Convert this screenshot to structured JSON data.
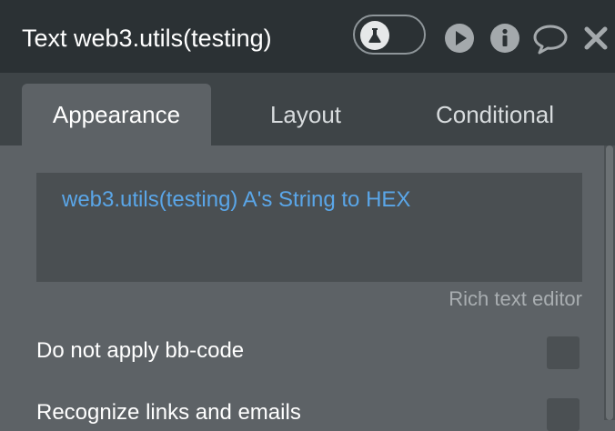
{
  "header": {
    "title": "Text web3.utils(testing)"
  },
  "tabs": [
    {
      "label": "Appearance",
      "active": true
    },
    {
      "label": "Layout",
      "active": false
    },
    {
      "label": "Conditional",
      "active": false
    }
  ],
  "editor": {
    "content": "web3.utils(testing) A's String to HEX"
  },
  "rich_text_link": "Rich text editor",
  "options": [
    {
      "label": "Do not apply bb-code",
      "checked": false
    },
    {
      "label": "Recognize links and emails",
      "checked": false
    }
  ],
  "colors": {
    "header_bg": "#2b3134",
    "panel_bg": "#5d6266",
    "tab_bar_bg": "#3e4447",
    "editor_text": "#5aa6e8"
  },
  "icons": [
    "flask-icon",
    "play-icon",
    "info-icon",
    "comment-icon",
    "close-icon"
  ]
}
